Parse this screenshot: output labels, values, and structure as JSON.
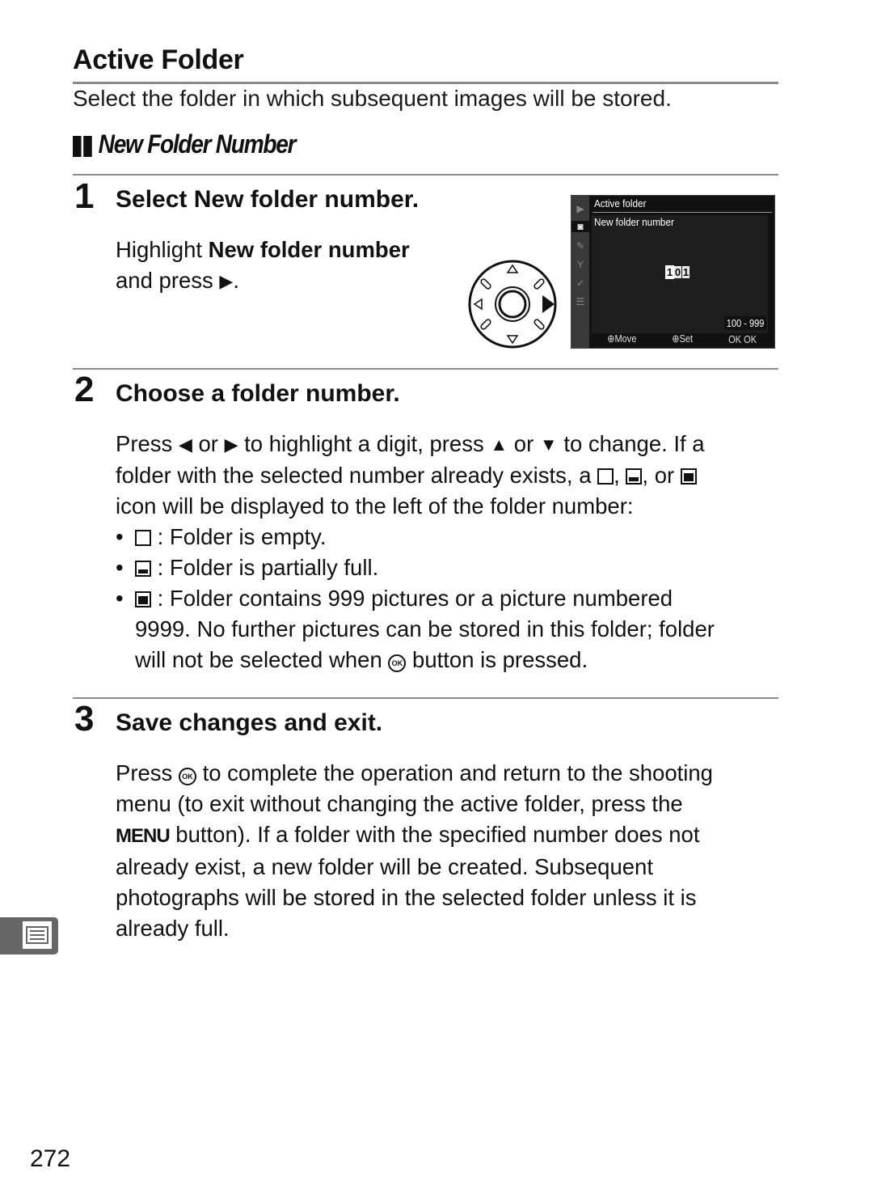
{
  "page": {
    "title": "Active Folder",
    "intro": "Select the folder in which subsequent images will be stored.",
    "section_heading": "New Folder Number",
    "page_number": "272",
    "side_tab_icon": "menu-list-icon"
  },
  "steps": [
    {
      "number": "1",
      "title_prefix": "Select ",
      "title_bold": "New folder number",
      "title_suffix": ".",
      "body_prefix": "Highlight ",
      "body_bold": "New folder number",
      "body_line2": "and press",
      "body_end": "."
    },
    {
      "number": "2",
      "title": "Choose a folder number.",
      "para": {
        "p1": "Press",
        "p2": "or",
        "p3": "to highlight a digit, press",
        "p4": "or",
        "p5": "to change.  If a",
        "p6": "folder with the selected number already exists, a",
        "p7": ",",
        "p8": ", or",
        "p9": "icon will be displayed to the left of the folder number:"
      },
      "bullets": [
        {
          "icon": "folder-empty-icon",
          "text": ": Folder is empty."
        },
        {
          "icon": "folder-partial-icon",
          "text": ": Folder is partially full."
        },
        {
          "icon": "folder-full-icon",
          "text": ": Folder contains 999 pictures or a picture numbered",
          "cont1": "9999.  No further pictures can be stored in this folder; folder",
          "cont2a": "will not be selected when",
          "cont2b": "button is pressed."
        }
      ]
    },
    {
      "number": "3",
      "title": "Save changes and exit.",
      "lines": {
        "l1a": "Press",
        "l1b": "to complete the operation and return to the shooting",
        "l2": "menu (to exit without changing the active folder, press the",
        "l3a": "MENU",
        "l3b": " button).  If a folder with the specified number does not",
        "l4": "already exist, a new folder will be created.  Subsequent",
        "l5": "photographs will be stored in the selected folder unless it is",
        "l6": "already full."
      }
    }
  ],
  "symbols": {
    "left": "◀",
    "right": "▶",
    "up": "▲",
    "down": "▼",
    "ok": "OK"
  },
  "camera_screen": {
    "menu_title": "Active folder",
    "sub_title": "New folder number",
    "digits": [
      "1",
      "0",
      "1"
    ],
    "selected_digit_index": 0,
    "range": "100 - 999",
    "footer": [
      "⊕Move",
      "⊕Set",
      "OK OK"
    ],
    "side_icons": [
      "playback-icon",
      "camera-icon",
      "pencil-icon",
      "wrench-icon",
      "retouch-icon",
      "recent-settings-icon"
    ],
    "active_side_icon": "camera-icon"
  },
  "multi_selector": {
    "pressed_direction": "right"
  }
}
